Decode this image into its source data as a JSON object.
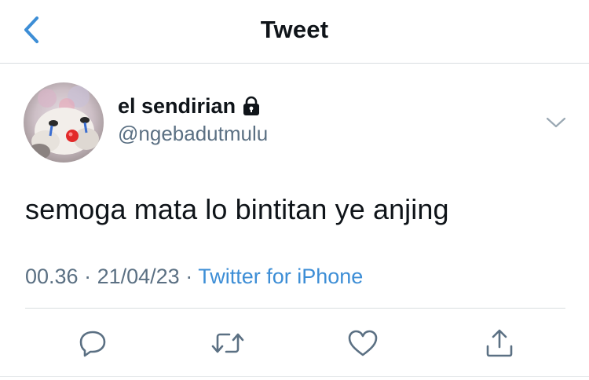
{
  "header": {
    "title": "Tweet",
    "back_icon": "chevron-left-icon"
  },
  "tweet": {
    "author": {
      "display_name": "el sendirian",
      "handle": "@ngebadutmulu",
      "protected_icon": "lock-icon"
    },
    "text": "semoga mata lo bintitan ye anjing",
    "time": "00.36",
    "date": "21/04/23",
    "source": "Twitter for iPhone"
  },
  "actions": [
    {
      "name": "reply",
      "icon": "reply-icon"
    },
    {
      "name": "retweet",
      "icon": "retweet-icon"
    },
    {
      "name": "like",
      "icon": "heart-icon"
    },
    {
      "name": "share",
      "icon": "share-icon"
    }
  ],
  "colors": {
    "accent": "#3d8ed6",
    "secondary_text": "#5b7083",
    "divider": "#d9dde0"
  }
}
